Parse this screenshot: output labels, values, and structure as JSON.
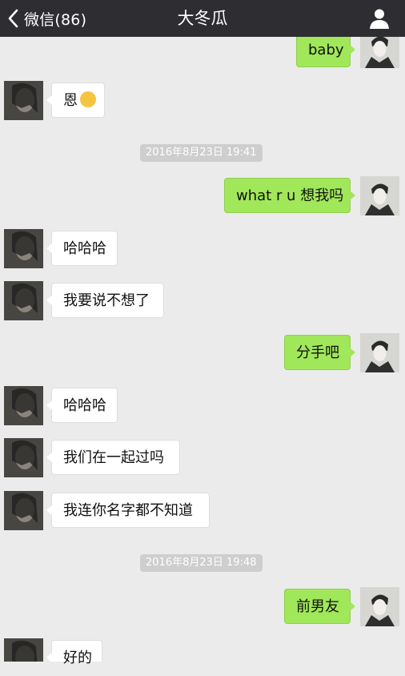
{
  "nav": {
    "back_label": "微信(86)",
    "title": "大冬瓜"
  },
  "timestamps": [
    "2016年8月23日 19:41",
    "2016年8月23日 19:48"
  ],
  "messages": [
    {
      "side": "me",
      "text": "baby"
    },
    {
      "side": "other",
      "text": "恩",
      "emoji": "disappointed-face-emoji"
    },
    {
      "side": "me",
      "text": "what r u 想我吗"
    },
    {
      "side": "other",
      "text": "哈哈哈"
    },
    {
      "side": "other",
      "text": "我要说不想了"
    },
    {
      "side": "me",
      "text": "分手吧"
    },
    {
      "side": "other",
      "text": "哈哈哈"
    },
    {
      "side": "other",
      "text": "我们在一起过吗"
    },
    {
      "side": "other",
      "text": "我连你名字都不知道"
    },
    {
      "side": "me",
      "text": "前男友"
    },
    {
      "side": "other",
      "text": "好的"
    }
  ],
  "colors": {
    "navbar": "#2e2e32",
    "background": "#ebebeb",
    "my_bubble": "#a0e75a",
    "their_bubble": "#ffffff",
    "timestamp_pill": "#cecece"
  }
}
